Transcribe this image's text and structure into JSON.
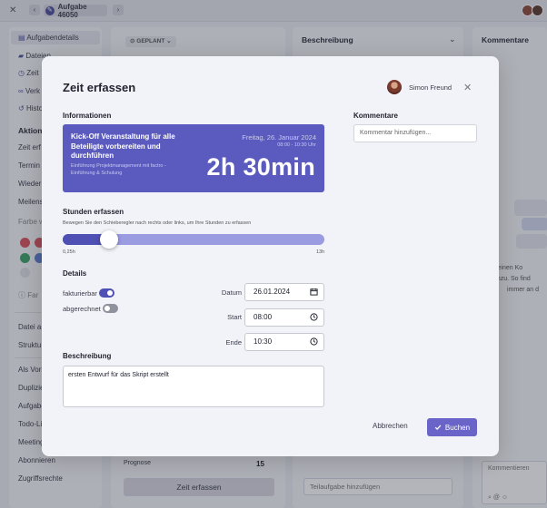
{
  "topbar": {
    "breadcrumb": "Aufgabe 46050"
  },
  "left_panel": {
    "items": [
      {
        "label": "Aufgabendetails"
      },
      {
        "label": "Dateien",
        "badge": "1"
      },
      {
        "label": "Zeit"
      },
      {
        "label": "Verk"
      },
      {
        "label": "Histo"
      }
    ],
    "actions_heading": "Aktion",
    "actions": [
      "Zeit erf",
      "Termin g",
      "Wieder",
      "Meilens"
    ],
    "color_label": "Farbe w",
    "colors": [
      "#d9545c",
      "#d9545c",
      "#3ea36b",
      "#5b7fd1"
    ],
    "info_text": "Far",
    "more_items": [
      "Datei an",
      "Struktu",
      "Als Vorl",
      "Duplizie",
      "Aufgabe",
      "Todo-Li",
      "Meeting",
      "Abonnieren",
      "Zugriffsrechte"
    ]
  },
  "middle_column": {
    "status": "GEPLANT",
    "prognose_label": "Prognose",
    "prognose_value": "15",
    "time_button": "Zeit erfassen"
  },
  "description_column": {
    "title": "Beschreibung",
    "subtask_placeholder": "Teilaufgabe hinzufügen"
  },
  "comments_column": {
    "title": "Kommentare",
    "empty_text": [
      "reibe einen Ko",
      "ei hinzu. So find",
      "immer an d"
    ],
    "input_label": "Kommentieren"
  },
  "modal": {
    "title": "Zeit erfassen",
    "user_name": "Simon Freund",
    "info_heading": "Informationen",
    "task": {
      "title": "Kick-Off Veranstaltung für alle Beteiligte vorbereiten und durchführen",
      "subtitle": "Einführung Projektmanagement mit factro - Einführung & Schulung",
      "date": "Freitag, 26. Januar 2024",
      "time": "08:00 - 10:30 Uhr",
      "duration": "2h 30min"
    },
    "hours_heading": "Stunden erfassen",
    "hours_hint": "Bewegen Sie den Schieberegler nach rechts oder links, um Ihre Stunden zu erfassen",
    "slider": {
      "min_label": "0,25h",
      "max_label": "13h",
      "min": 0.25,
      "max": 13,
      "value": 2.5
    },
    "details_heading": "Details",
    "billable_label": "fakturierbar",
    "billable": true,
    "settled_label": "abgerechnet",
    "settled": false,
    "date_label": "Datum",
    "date_value": "26.01.2024",
    "start_label": "Start",
    "start_value": "08:00",
    "end_label": "Ende",
    "end_value": "10:30",
    "description_heading": "Beschreibung",
    "description_value": "ersten Entwurf für das Skript erstellt",
    "comments_heading": "Kommentare",
    "comment_placeholder": "Kommentar hinzufügen...",
    "cancel_label": "Abbrechen",
    "submit_label": "Buchen"
  },
  "colors": {
    "accent": "#5b5bbf",
    "accent_dark": "#4f50b3",
    "button": "#6a64c8"
  }
}
